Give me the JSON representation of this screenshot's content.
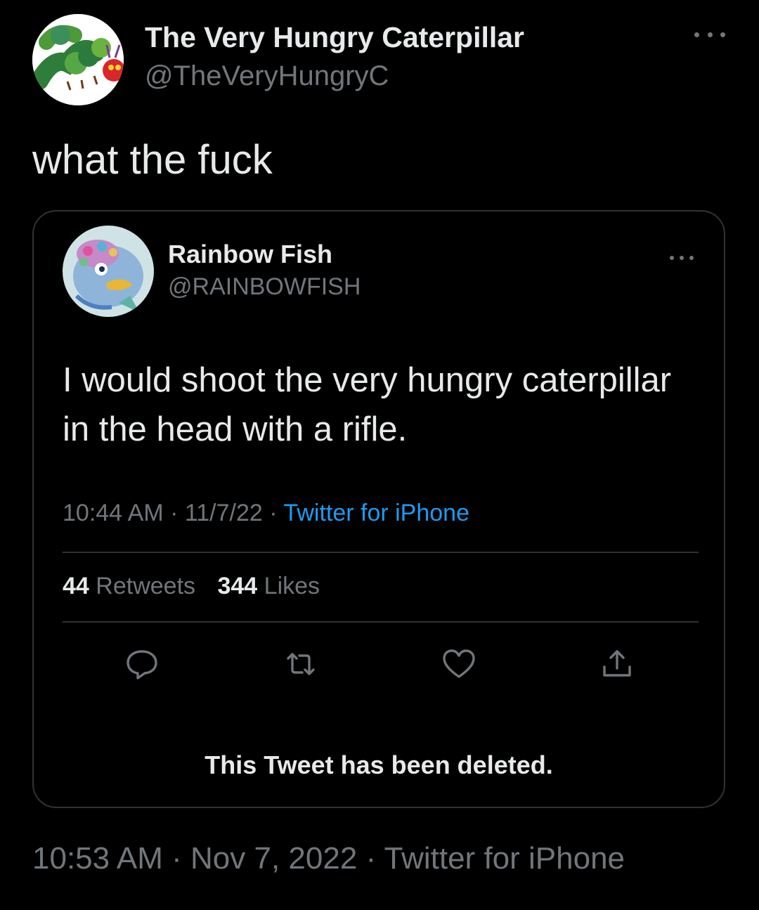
{
  "tweet": {
    "author": {
      "display_name": "The Very Hungry Caterpillar",
      "handle": "@TheVeryHungryC",
      "avatar_icon": "caterpillar-avatar"
    },
    "text": "what the fuck",
    "time": "10:53 AM",
    "date": "Nov 7, 2022",
    "source": "Twitter for iPhone",
    "separator": "·"
  },
  "quoted": {
    "author": {
      "display_name": "Rainbow Fish",
      "handle": "@RAINBOWFISH",
      "avatar_icon": "rainbow-fish-avatar"
    },
    "text": "I would shoot the very hungry caterpillar in the head with a rifle.",
    "time": "10:44 AM",
    "date": "11/7/22",
    "source": "Twitter for iPhone",
    "separator": "·",
    "stats": {
      "retweets_count": "44",
      "retweets_label": "Retweets",
      "likes_count": "344",
      "likes_label": "Likes"
    },
    "actions": [
      "reply-icon",
      "retweet-icon",
      "like-icon",
      "share-icon"
    ],
    "deleted_notice": "This Tweet has been deleted."
  },
  "colors": {
    "background": "#000000",
    "primary_text": "#e7e9ea",
    "secondary_text": "#71767b",
    "link": "#1d9bf0",
    "border": "#2f3336"
  }
}
